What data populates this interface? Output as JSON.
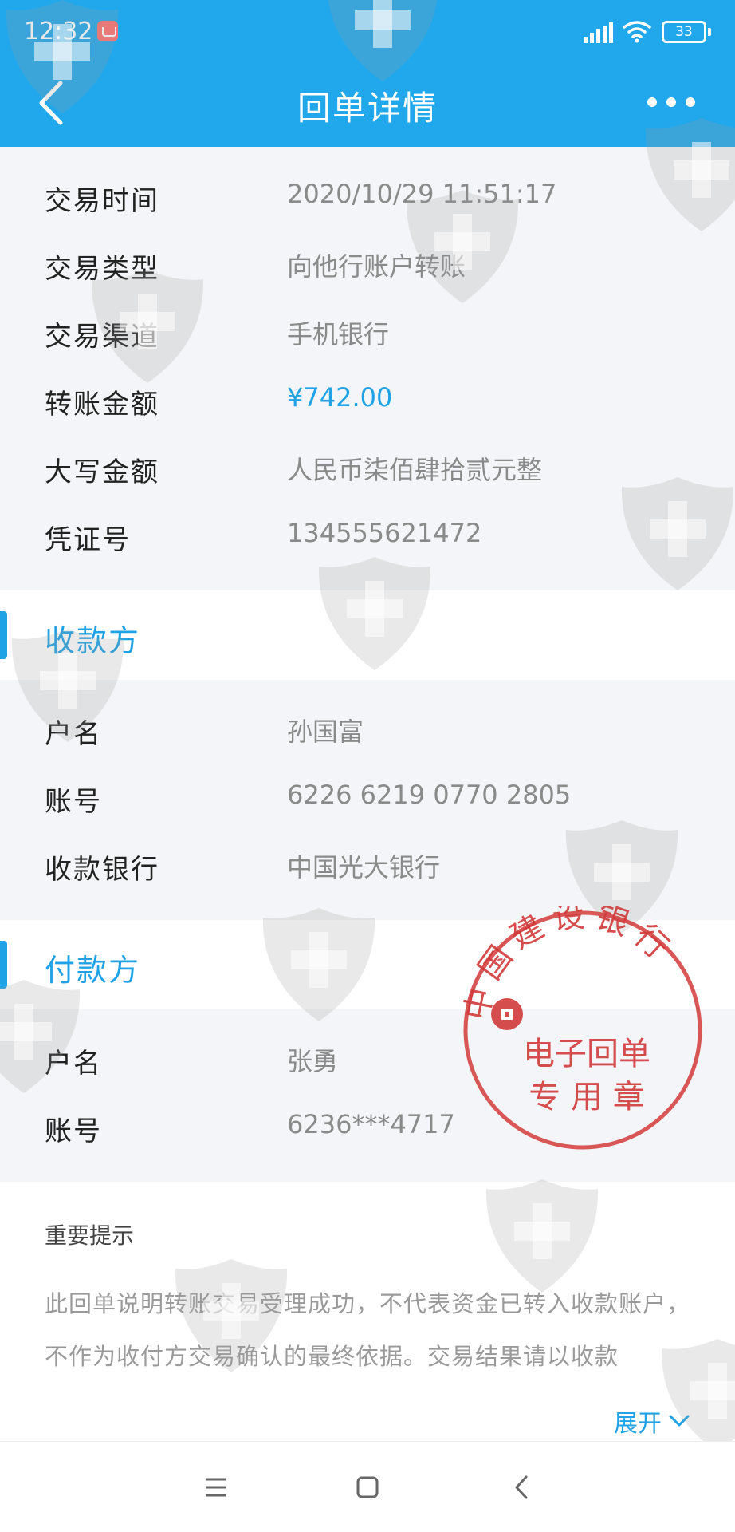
{
  "status_bar": {
    "time": "12:32",
    "battery": "33",
    "icons": [
      "app-notification-icon",
      "signal-icon",
      "wifi-icon",
      "battery-icon"
    ]
  },
  "app_bar": {
    "title": "回单详情",
    "back_icon": "chevron-left-icon",
    "more_icon": "more-horizontal-icon"
  },
  "transaction": [
    {
      "label": "交易时间",
      "value": "2020/10/29  11:51:17"
    },
    {
      "label": "交易类型",
      "value": "向他行账户转账"
    },
    {
      "label": "交易渠道",
      "value": "手机银行"
    },
    {
      "label": "转账金额",
      "value": "¥742.00"
    },
    {
      "label": "大写金额",
      "value": "人民币柒佰肆拾贰元整"
    },
    {
      "label": "凭证号",
      "value": "134555621472"
    }
  ],
  "payee": {
    "title": "收款方",
    "rows": [
      {
        "label": "户名",
        "value": "孙国富"
      },
      {
        "label": "账号",
        "value": "6226 6219 0770 2805"
      },
      {
        "label": "收款银行",
        "value": "中国光大银行"
      }
    ]
  },
  "payer": {
    "title": "付款方",
    "rows": [
      {
        "label": "户名",
        "value": "张勇"
      },
      {
        "label": "账号",
        "value": "6236***4717"
      }
    ]
  },
  "notice": {
    "title": "重要提示",
    "body": "此回单说明转账交易受理成功，不代表资金已转入收款账户，不作为收付方交易确认的最终依据。交易结果请以收款",
    "expand_label": "展开"
  },
  "stamp": {
    "bank_name": "中国建设银行",
    "line1": "电子回单",
    "line2": "专 用 章",
    "color": "#d23a3a"
  },
  "colors": {
    "header": "#21a8ec",
    "accent": "#1fa3e6",
    "row_background": "#f3f5f8"
  },
  "nav_bar": {
    "icons": [
      "menu-icon",
      "home-square-icon",
      "back-icon"
    ]
  }
}
